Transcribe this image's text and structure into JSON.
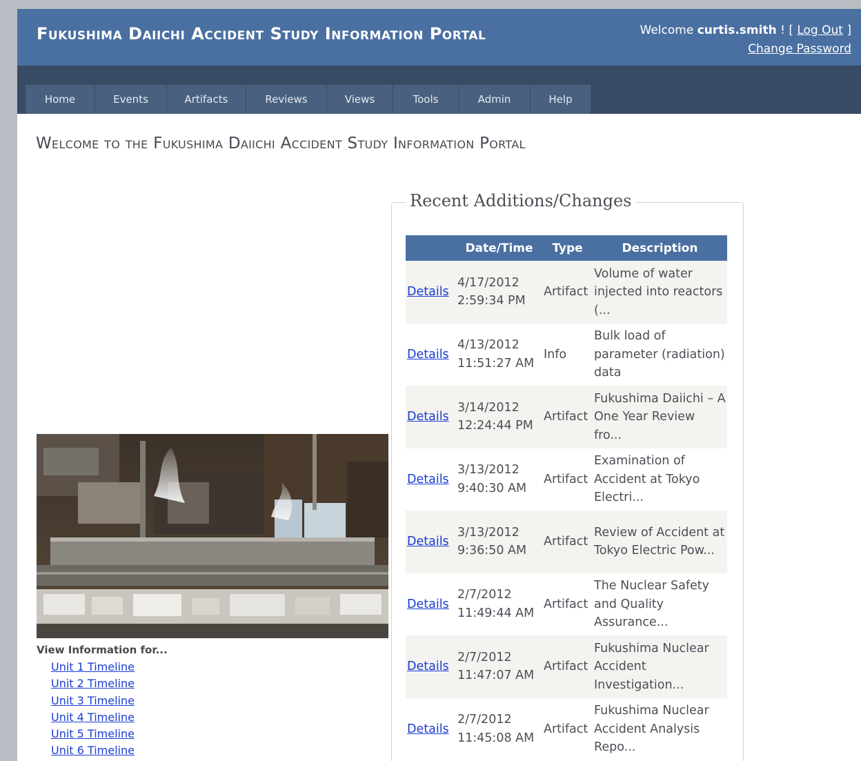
{
  "header": {
    "title": "Fukushima Daiichi Accident Study Information Portal",
    "welcome_prefix": "Welcome",
    "username": "curtis.smith",
    "welcome_suffix": "! [",
    "logout_label": "Log Out",
    "bracket_close": "]",
    "change_password_label": "Change Password"
  },
  "nav": {
    "items": [
      "Home",
      "Events",
      "Artifacts",
      "Reviews",
      "Views",
      "Tools",
      "Admin",
      "Help"
    ]
  },
  "main": {
    "heading": "Welcome to the Fukushima Daiichi Accident Study Information Portal",
    "view_info_label": "View Information for...",
    "timeline_links": [
      "Unit 1 Timeline",
      "Unit 2 Timeline",
      "Unit 3 Timeline",
      "Unit 4 Timeline",
      "Unit 5 Timeline",
      "Unit 6 Timeline"
    ]
  },
  "recent": {
    "legend": "Recent Additions/Changes",
    "columns": [
      "",
      "Date/Time",
      "Type",
      "Description"
    ],
    "rows": [
      {
        "details": "Details",
        "date": "4/17/2012",
        "time": "2:59:34 PM",
        "type": "Artifact",
        "description": "Volume of water injected into reactors (..."
      },
      {
        "details": "Details",
        "date": "4/13/2012",
        "time": "11:51:27 AM",
        "type": "Info",
        "description": "Bulk load of parameter (radiation) data"
      },
      {
        "details": "Details",
        "date": "3/14/2012",
        "time": "12:24:44 PM",
        "type": "Artifact",
        "description": "Fukushima Daiichi – A One Year Review fro..."
      },
      {
        "details": "Details",
        "date": "3/13/2012",
        "time": "9:40:30 AM",
        "type": "Artifact",
        "description": "Examination of Accident at Tokyo Electri..."
      },
      {
        "details": "Details",
        "date": "3/13/2012",
        "time": "9:36:50 AM",
        "type": "Artifact",
        "description": "Review of Accident at Tokyo Electric Pow..."
      },
      {
        "details": "Details",
        "date": "2/7/2012",
        "time": "11:49:44 AM",
        "type": "Artifact",
        "description": "The Nuclear Safety and Quality Assurance..."
      },
      {
        "details": "Details",
        "date": "2/7/2012",
        "time": "11:47:07 AM",
        "type": "Artifact",
        "description": "Fukushima Nuclear Accident Investigation..."
      },
      {
        "details": "Details",
        "date": "2/7/2012",
        "time": "11:45:08 AM",
        "type": "Artifact",
        "description": "Fukushima Nuclear Accident Analysis Repo..."
      }
    ]
  },
  "colors": {
    "header_bg": "#4a6fa1",
    "nav_band": "#384b65",
    "tab_bg": "#49607f",
    "link": "#1a3cd4"
  }
}
